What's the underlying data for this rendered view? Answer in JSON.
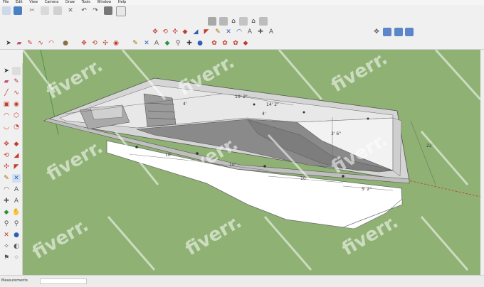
{
  "menu": [
    "File",
    "Edit",
    "View",
    "Camera",
    "Draw",
    "Tools",
    "Window",
    "Help"
  ],
  "icons": {
    "top": [
      "pointer-icon",
      "save-icon",
      "cut-icon",
      "copy-icon",
      "paste-icon",
      "erase-icon",
      "undo-icon",
      "redo-icon",
      "print-icon",
      "model-info-icon"
    ],
    "views": [
      "iso-view-icon",
      "top-view-icon",
      "front-view-icon",
      "right-view-icon",
      "back-view-icon",
      "left-view-icon"
    ],
    "standard": [
      "camera-orbit-icon",
      "pan-icon",
      "zoom-icon",
      "zoom-window-icon",
      "zoom-extents-icon",
      "previous-view-icon",
      "next-view-icon",
      "position-camera-icon",
      "walk-icon",
      "look-around-icon"
    ],
    "styles": [
      "xray-icon",
      "back-edges-icon",
      "wireframe-icon",
      "hidden-line-icon",
      "shaded-icon"
    ]
  },
  "colors": {
    "ground": "#8fb174",
    "wall": "#ffffff",
    "floor": "#8a8a8a",
    "deck": "#bfbfbf",
    "axis_red": "#c23b2e",
    "axis_green": "#3f8f3f",
    "axis_blue": "#3a4fd0"
  },
  "model": {
    "dimensions": [
      "10'",
      "10'",
      "10'",
      "5' 2\"",
      "3' 6\"",
      "22'",
      "4'",
      "4'",
      "10' 2\"",
      "14' 2\""
    ]
  },
  "watermark": "fiverr.",
  "status": {
    "label": "Measurements",
    "value": ""
  }
}
